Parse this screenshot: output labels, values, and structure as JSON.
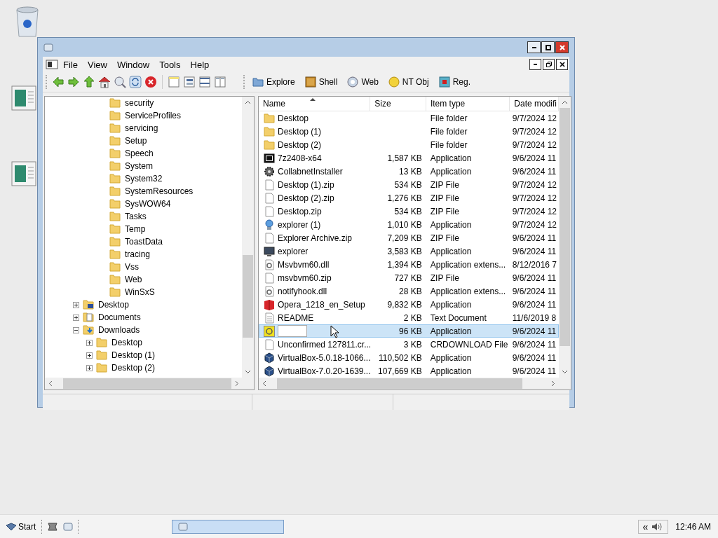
{
  "menu": [
    "File",
    "View",
    "Window",
    "Tools",
    "Help"
  ],
  "toolbar": {
    "buttons": [
      {
        "label": "Explore"
      },
      {
        "label": "Shell"
      },
      {
        "label": "Web"
      },
      {
        "label": "NT Obj"
      },
      {
        "label": "Reg."
      }
    ]
  },
  "tree": {
    "items": [
      {
        "children": [
          {
            "children": [
              {
                "label": "security",
                "kind": "folder"
              },
              {
                "label": "ServiceProfiles",
                "kind": "folder"
              },
              {
                "label": "servicing",
                "kind": "folder"
              },
              {
                "label": "Setup",
                "kind": "folder"
              },
              {
                "label": "Speech",
                "kind": "folder"
              },
              {
                "label": "System",
                "kind": "folder"
              },
              {
                "label": "System32",
                "kind": "folder"
              },
              {
                "label": "SystemResources",
                "kind": "folder"
              },
              {
                "label": "SysWOW64",
                "kind": "folder"
              },
              {
                "label": "Tasks",
                "kind": "folder"
              },
              {
                "label": "Temp",
                "kind": "folder"
              },
              {
                "label": "ToastData",
                "kind": "folder"
              },
              {
                "label": "tracing",
                "kind": "folder"
              },
              {
                "label": "Vss",
                "kind": "folder"
              },
              {
                "label": "Web",
                "kind": "folder"
              },
              {
                "label": "WinSxS",
                "kind": "folder"
              }
            ]
          }
        ]
      },
      {
        "label": "Desktop",
        "kind": "desktop",
        "expanded": false
      },
      {
        "label": "Documents",
        "kind": "documents",
        "expanded": false
      },
      {
        "label": "Downloads",
        "kind": "downloads",
        "expanded": true,
        "children": [
          {
            "label": "Desktop",
            "kind": "folder",
            "expanded": false
          },
          {
            "label": "Desktop (1)",
            "kind": "folder",
            "expanded": false
          },
          {
            "label": "Desktop (2)",
            "kind": "folder",
            "expanded": false
          }
        ]
      }
    ]
  },
  "list": {
    "columns": [
      {
        "label": "Name",
        "sorted": true
      },
      {
        "label": "Size",
        "sorted": false
      },
      {
        "label": "Item type",
        "sorted": false
      },
      {
        "label": "Date modifi",
        "sorted": false
      }
    ],
    "rows": [
      {
        "name": "Desktop",
        "type": "File folder",
        "date": "9/7/2024 12",
        "kind": "folder",
        "selected": false
      },
      {
        "name": "Desktop (1)",
        "type": "File folder",
        "date": "9/7/2024 12",
        "kind": "folder",
        "selected": false
      },
      {
        "name": "Desktop (2)",
        "type": "File folder",
        "date": "9/7/2024 12",
        "kind": "folder",
        "selected": false
      },
      {
        "name": "7z2408-x64",
        "size": "1,587 KB",
        "type": "Application",
        "date": "9/6/2024 11",
        "kind": "archiver",
        "selected": false
      },
      {
        "name": "CollabnetInstaller",
        "size": "13 KB",
        "type": "Application",
        "date": "9/6/2024 11",
        "kind": "gear",
        "selected": false
      },
      {
        "name": "Desktop (1).zip",
        "size": "534 KB",
        "type": "ZIP File",
        "date": "9/7/2024 12",
        "kind": "file",
        "selected": false
      },
      {
        "name": "Desktop (2).zip",
        "size": "1,276 KB",
        "type": "ZIP File",
        "date": "9/7/2024 12",
        "kind": "file",
        "selected": false
      },
      {
        "name": "Desktop.zip",
        "size": "534 KB",
        "type": "ZIP File",
        "date": "9/7/2024 12",
        "kind": "file",
        "selected": false
      },
      {
        "name": "explorer (1)",
        "size": "1,010 KB",
        "type": "Application",
        "date": "9/7/2024 12",
        "kind": "globe",
        "selected": false
      },
      {
        "name": "Explorer Archive.zip",
        "size": "7,209 KB",
        "type": "ZIP File",
        "date": "9/6/2024 11",
        "kind": "file",
        "selected": false
      },
      {
        "name": "explorer",
        "size": "3,583 KB",
        "type": "Application",
        "date": "9/6/2024 11",
        "kind": "monitor",
        "selected": false
      },
      {
        "name": "Msvbvm60.dll",
        "size": "1,394 KB",
        "type": "Application extens...",
        "date": "8/12/2016 7",
        "kind": "dll",
        "selected": false
      },
      {
        "name": "msvbvm60.zip",
        "size": "727 KB",
        "type": "ZIP File",
        "date": "9/6/2024 11",
        "kind": "file",
        "selected": false
      },
      {
        "name": "notifyhook.dll",
        "size": "28 KB",
        "type": "Application extens...",
        "date": "9/6/2024 11",
        "kind": "dll",
        "selected": false
      },
      {
        "name": "Opera_1218_en_Setup",
        "size": "9,832 KB",
        "type": "Application",
        "date": "9/6/2024 11",
        "kind": "red",
        "selected": false
      },
      {
        "name": "README",
        "size": "2 KB",
        "type": "Text Document",
        "date": "11/6/2019 8",
        "kind": "text",
        "selected": false
      },
      {
        "editing": true,
        "size": "96 KB",
        "type": "Application",
        "date": "9/6/2024 11",
        "kind": "yellow",
        "selected": true
      },
      {
        "name": "Unconfirmed 127811.cr...",
        "size": "3 KB",
        "type": "CRDOWNLOAD File",
        "date": "9/6/2024 11",
        "kind": "file",
        "selected": false
      },
      {
        "name": "VirtualBox-5.0.18-1066...",
        "size": "110,502 KB",
        "type": "Application",
        "date": "9/6/2024 11",
        "kind": "cube",
        "selected": false
      },
      {
        "name": "VirtualBox-7.0.20-1639...",
        "size": "107,669 KB",
        "type": "Application",
        "date": "9/6/2024 11",
        "kind": "cube",
        "selected": false
      }
    ]
  },
  "taskbar": {
    "start": "Start",
    "tray_expand": "«",
    "clock": "12:46 AM"
  }
}
